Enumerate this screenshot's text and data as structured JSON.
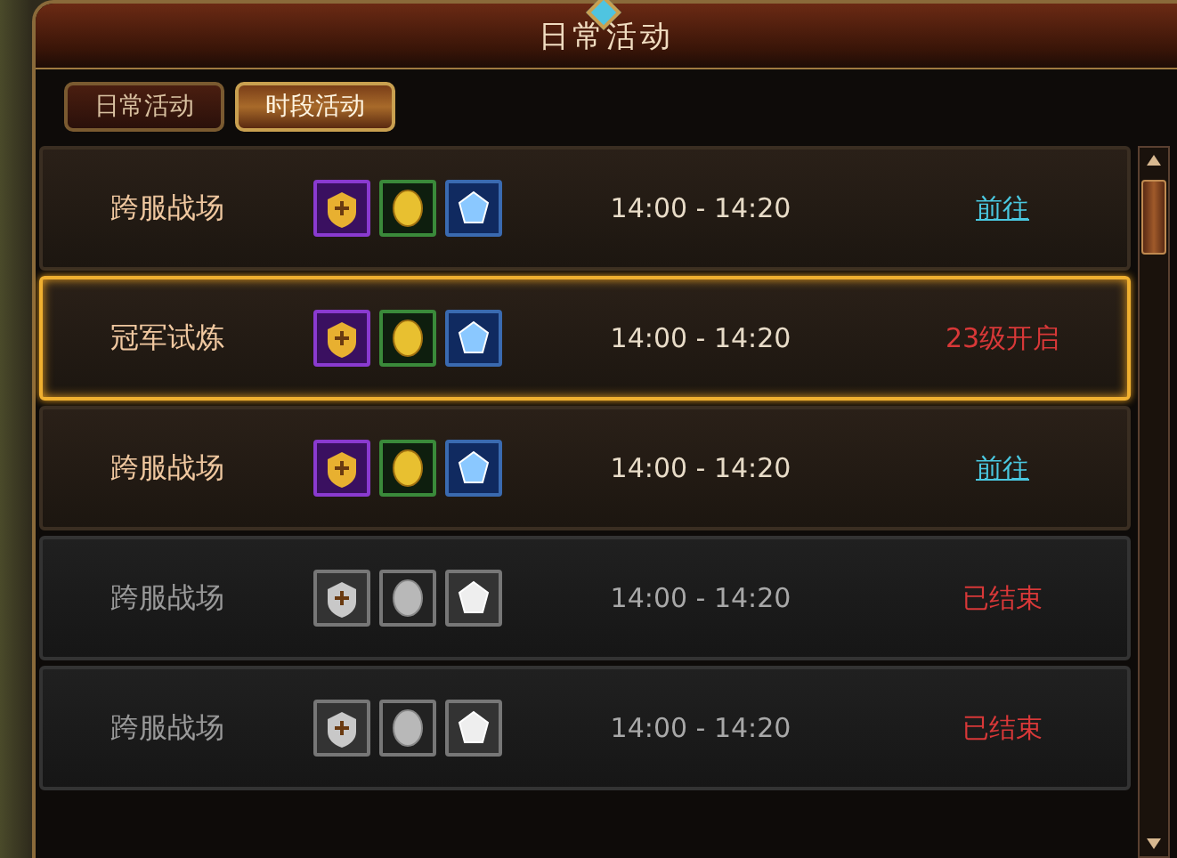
{
  "window": {
    "title": "日常活动"
  },
  "tabs": [
    {
      "label": "日常活动",
      "selected": false
    },
    {
      "label": "时段活动",
      "selected": true
    }
  ],
  "rows": [
    {
      "name": "跨服战场",
      "selected": false,
      "disabled": false,
      "rewards": [
        {
          "kind": "badge"
        },
        {
          "kind": "coin"
        },
        {
          "kind": "gem"
        }
      ],
      "time": "14:00 - 14:20",
      "action": {
        "kind": "link",
        "text": "前往"
      }
    },
    {
      "name": "冠军试炼",
      "selected": true,
      "disabled": false,
      "rewards": [
        {
          "kind": "badge"
        },
        {
          "kind": "coin"
        },
        {
          "kind": "gem"
        }
      ],
      "time": "14:00 - 14:20",
      "action": {
        "kind": "status",
        "text": "23级开启"
      }
    },
    {
      "name": "跨服战场",
      "selected": false,
      "disabled": false,
      "rewards": [
        {
          "kind": "badge"
        },
        {
          "kind": "coin"
        },
        {
          "kind": "gem"
        }
      ],
      "time": "14:00 - 14:20",
      "action": {
        "kind": "link",
        "text": "前往"
      }
    },
    {
      "name": "跨服战场",
      "selected": false,
      "disabled": true,
      "rewards": [
        {
          "kind": "badge"
        },
        {
          "kind": "coin"
        },
        {
          "kind": "gem"
        }
      ],
      "time": "14:00 - 14:20",
      "action": {
        "kind": "status",
        "text": "已结束"
      }
    },
    {
      "name": "跨服战场",
      "selected": false,
      "disabled": true,
      "rewards": [
        {
          "kind": "badge"
        },
        {
          "kind": "coin"
        },
        {
          "kind": "gem"
        }
      ],
      "time": "14:00 - 14:20",
      "action": {
        "kind": "status",
        "text": "已结束"
      }
    }
  ]
}
